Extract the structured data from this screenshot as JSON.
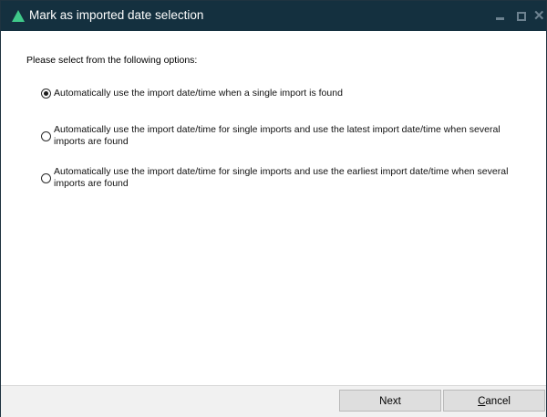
{
  "window": {
    "title": "Mark as imported date selection",
    "icon": "green-triangle-icon",
    "minimize_icon": "minimize-icon",
    "maximize_icon": "maximize-icon",
    "close_icon": "close-icon",
    "close_glyph": "✕"
  },
  "dialog": {
    "prompt": "Please select from the following options:",
    "options": [
      {
        "label": "Automatically use the import date/time when a single import is found",
        "selected": true
      },
      {
        "label": "Automatically use the import date/time for single imports and use the latest import date/time when several imports are found",
        "selected": false
      },
      {
        "label": "Automatically use the import date/time for single imports and use the earliest import date/time when several imports are found",
        "selected": false
      }
    ]
  },
  "footer": {
    "next_label": "Next",
    "cancel_label_mnemonic": "C",
    "cancel_label_rest": "ancel"
  },
  "colors": {
    "titlebar": "#14303f",
    "accent": "#3fc98a",
    "button_bg": "#dedede",
    "footer_bg": "#f1f1f1"
  }
}
